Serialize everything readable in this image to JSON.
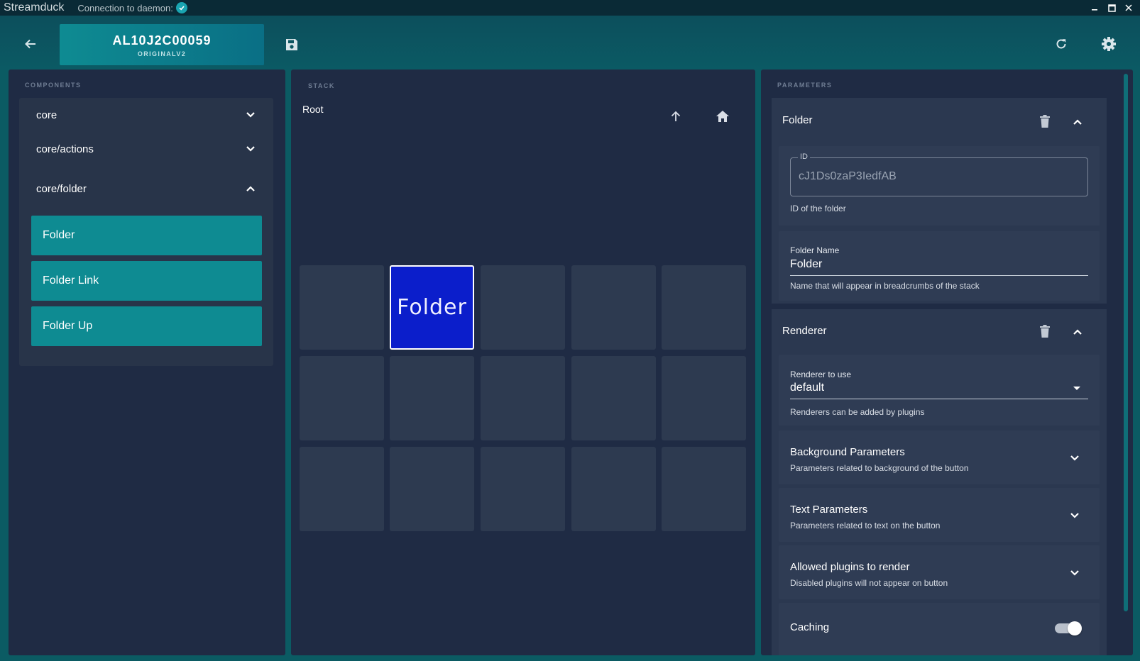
{
  "titlebar": {
    "app_name": "Streamduck",
    "connection_label": "Connection to daemon:",
    "connection_icon": "check-circle-icon"
  },
  "header": {
    "device_serial": "AL10J2C00059",
    "device_model": "ORIGINALV2"
  },
  "components": {
    "title": "COMPONENTS",
    "groups": [
      {
        "label": "core",
        "expanded": false
      },
      {
        "label": "core/actions",
        "expanded": false
      },
      {
        "label": "core/folder",
        "expanded": true
      }
    ],
    "items": [
      "Folder",
      "Folder Link",
      "Folder Up"
    ]
  },
  "stack": {
    "title": "STACK",
    "breadcrumb": "Root",
    "selected_button_label": "Folder"
  },
  "parameters": {
    "title": "PARAMETERS",
    "folder": {
      "header": "Folder",
      "id_label": "ID",
      "id_value": "cJ1Ds0zaP3IedfAB",
      "id_help": "ID of the folder",
      "name_label": "Folder Name",
      "name_value": "Folder",
      "name_help": "Name that will appear in breadcrumbs of the stack"
    },
    "renderer": {
      "header": "Renderer",
      "renderer_label": "Renderer to use",
      "renderer_value": "default",
      "renderer_help": "Renderers can be added by plugins",
      "sections": [
        {
          "title": "Background Parameters",
          "desc": "Parameters related to background of the button"
        },
        {
          "title": "Text Parameters",
          "desc": "Parameters related to text on the button"
        },
        {
          "title": "Allowed plugins to render",
          "desc": "Disabled plugins will not appear on button"
        }
      ],
      "caching_label": "Caching",
      "caching_enabled": true
    }
  },
  "colors": {
    "accent": "#0e8b92",
    "panel": "#1f2b44",
    "selected_button": "#0b1ecb"
  }
}
